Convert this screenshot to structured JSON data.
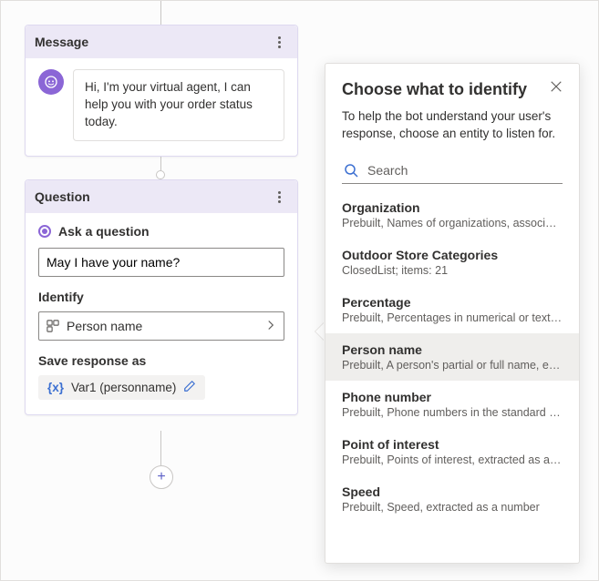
{
  "message_card": {
    "title": "Message",
    "bubble_text": "Hi, I'm your virtual agent, I can help you with your order status today."
  },
  "question_card": {
    "title": "Question",
    "step_label": "Ask a question",
    "question_value": "May I have your name?",
    "identify_label": "Identify",
    "identify_value": "Person name",
    "save_label": "Save response as",
    "variable_name": "Var1 (personname)"
  },
  "panel": {
    "title": "Choose what to identify",
    "description": "To help the bot understand your user's response, choose an entity to listen for.",
    "search_placeholder": "Search",
    "selected_index": 3,
    "entities": [
      {
        "name": "Organization",
        "desc": "Prebuilt, Names of organizations, associations."
      },
      {
        "name": "Outdoor Store Categories",
        "desc": "ClosedList; items: 21"
      },
      {
        "name": "Percentage",
        "desc": "Prebuilt, Percentages in numerical or text for..."
      },
      {
        "name": "Person name",
        "desc": "Prebuilt, A person's partial or full name, extra..."
      },
      {
        "name": "Phone number",
        "desc": "Prebuilt, Phone numbers in the standard US f..."
      },
      {
        "name": "Point of interest",
        "desc": "Prebuilt, Points of interest, extracted as a string"
      },
      {
        "name": "Speed",
        "desc": "Prebuilt, Speed, extracted as a number"
      }
    ]
  }
}
